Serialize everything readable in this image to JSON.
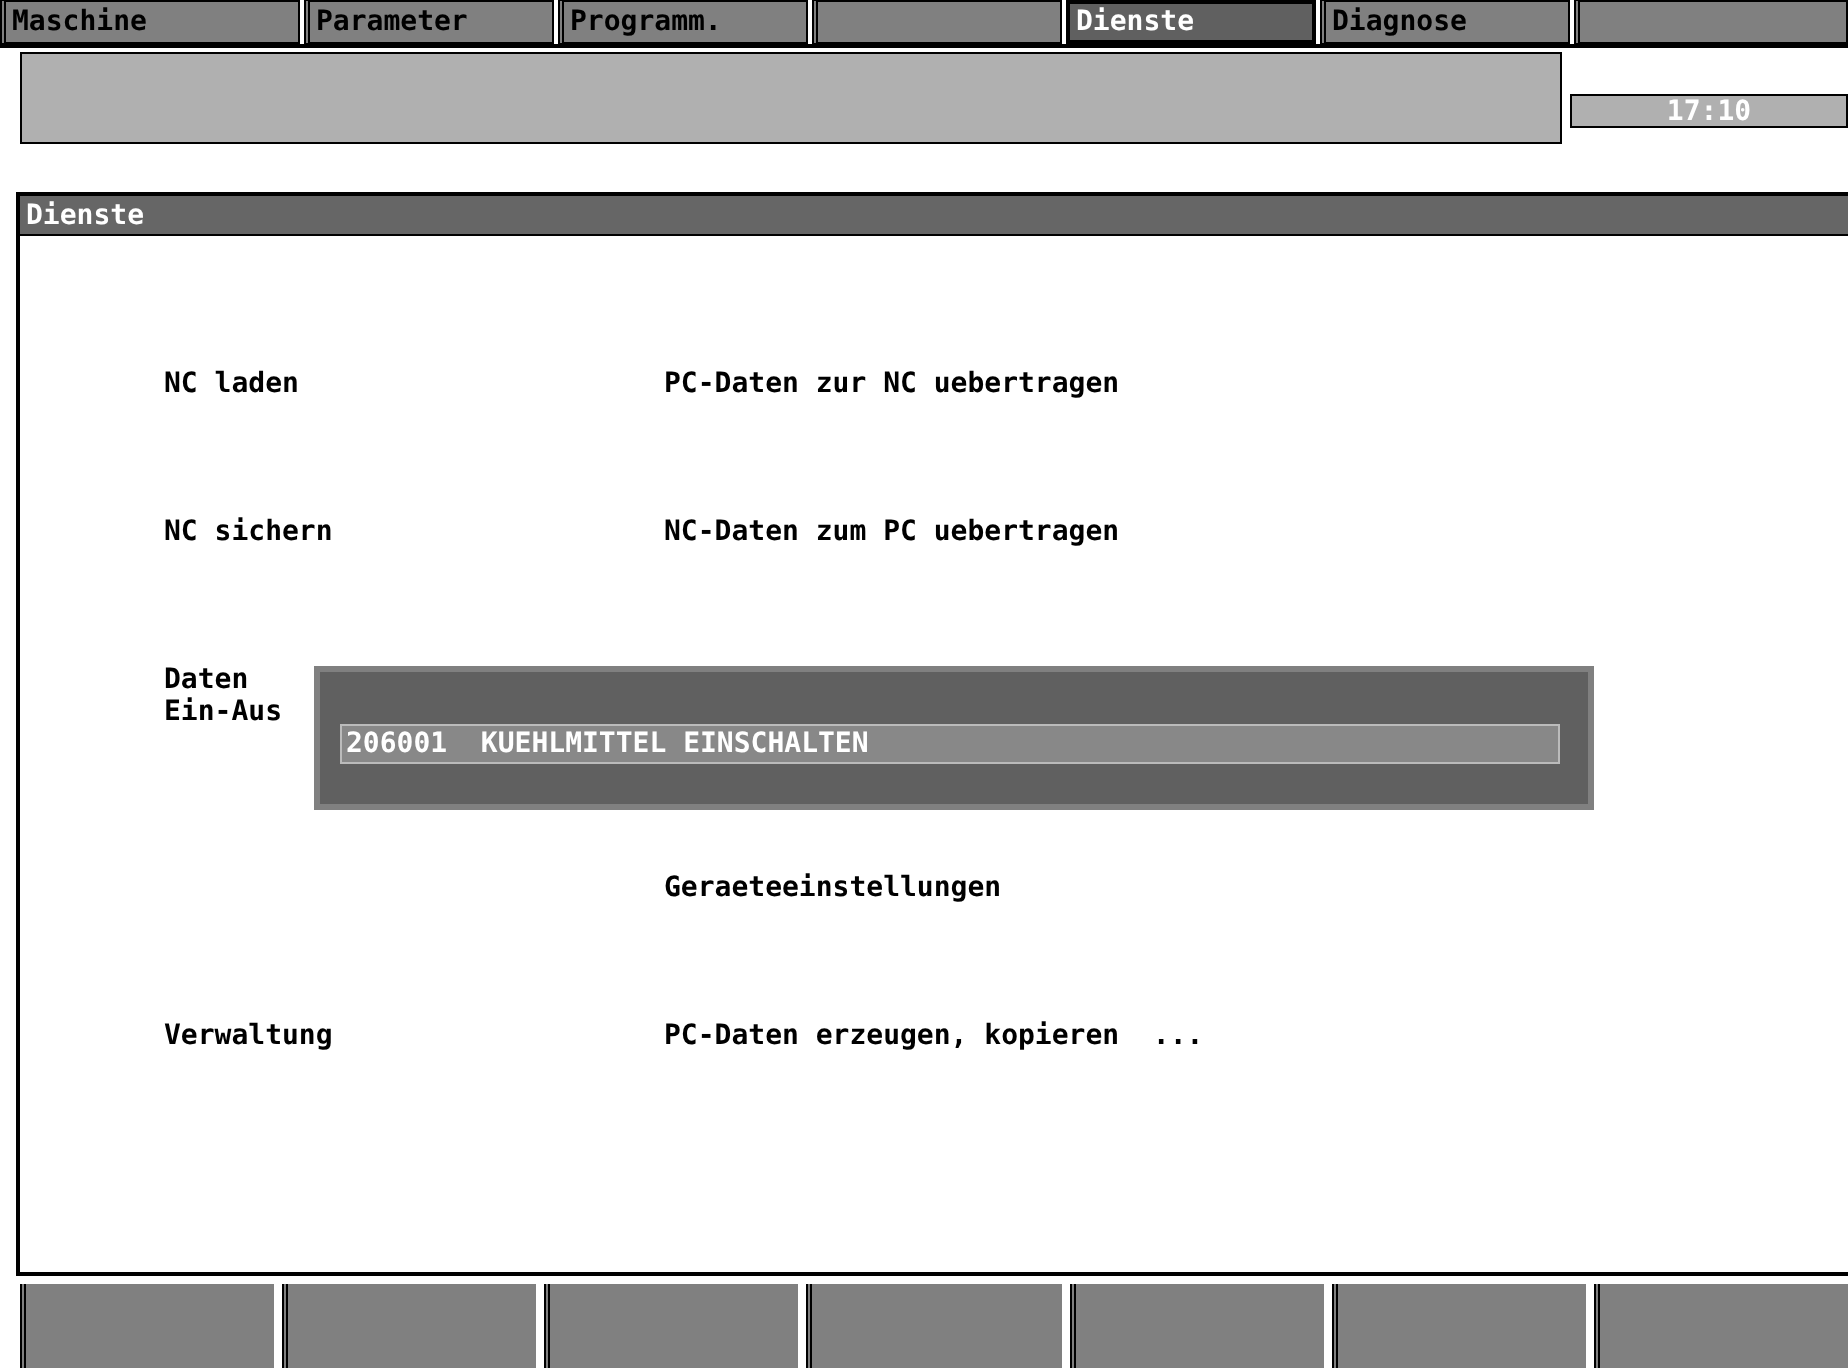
{
  "tabs": [
    {
      "label": "Maschine",
      "selected": false
    },
    {
      "label": "Parameter",
      "selected": false
    },
    {
      "label": "Programm.",
      "selected": false
    },
    {
      "selected": false
    },
    {
      "label": "Dienste",
      "selected": true
    },
    {
      "label": "Diagnose",
      "selected": false
    },
    {
      "selected": false
    }
  ],
  "clock": "17:10",
  "panel": {
    "title": "Dienste",
    "items": [
      {
        "label": [
          "NC laden"
        ],
        "description": "PC-Daten zur NC uebertragen"
      },
      {
        "label": [
          "NC sichern"
        ],
        "description": "NC-Daten zum PC uebertragen"
      },
      {
        "label": [
          "Daten",
          "Ein-Aus"
        ]
      },
      {
        "description": "Geraeteeinstellungen"
      },
      {
        "label": [
          "Verwaltung"
        ],
        "description": "PC-Daten erzeugen, kopieren  ..."
      }
    ]
  },
  "alarm": {
    "text": "206001  KUEHLMITTEL EINSCHALTEN"
  },
  "softkeys": [
    {
      "kind": "empty"
    },
    {
      "kind": "empty"
    },
    {
      "kind": "empty"
    },
    {
      "kind": "empty"
    },
    {
      "kind": "empty"
    },
    {
      "kind": "empty"
    },
    {
      "kind": "empty"
    }
  ]
}
